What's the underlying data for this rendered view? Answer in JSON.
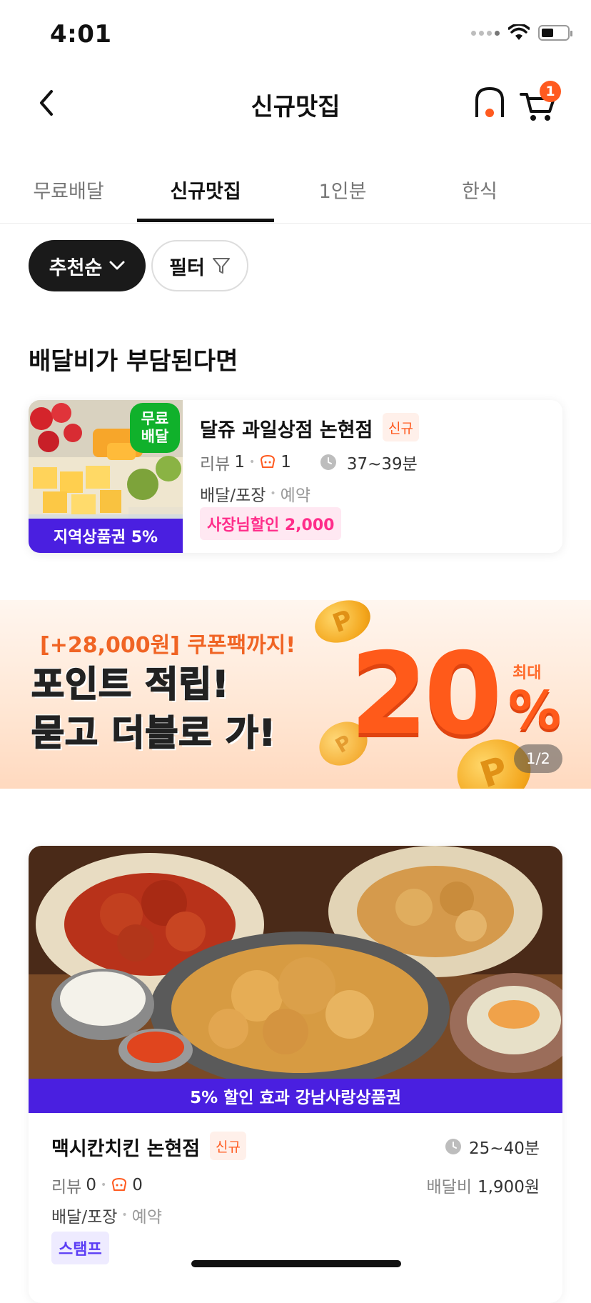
{
  "status_bar": {
    "time": "4:01"
  },
  "header": {
    "title": "신규맛집",
    "cart_count": "1"
  },
  "tabs": [
    {
      "label": "무료배달"
    },
    {
      "label": "신규맛집"
    },
    {
      "label": "1인분"
    },
    {
      "label": "한식"
    }
  ],
  "filters": {
    "sort_label": "추천순",
    "filter_label": "필터"
  },
  "section": {
    "title": "배달비가 부담된다면"
  },
  "store1": {
    "free_badge_line1": "무료",
    "free_badge_line2": "배달",
    "voucher": "지역상품권 5%",
    "name": "달쥬 과일상점 논현점",
    "new_tag": "신규",
    "review_label": "리뷰",
    "review_count": "1",
    "rating_count": "1",
    "delivery_time": "37~39분",
    "mode": "배달/포장",
    "mode_sub": "예약",
    "discount": "사장님할인 2,000"
  },
  "banner": {
    "subtitle": "[+28,000원] 쿠폰팩까지!",
    "line1": "포인트 적립!",
    "line2": "묻고 더블로 가!",
    "big_number": "20",
    "percent": "%",
    "max_label": "최대",
    "pager": "1/2"
  },
  "store2": {
    "voucher": "5% 할인 효과 강남사랑상품권",
    "name": "맥시칸치킨 논현점",
    "new_tag": "신규",
    "delivery_time": "25~40분",
    "review_label": "리뷰",
    "review_count": "0",
    "rating_count": "0",
    "fee_label": "배달비",
    "fee_value": "1,900원",
    "mode": "배달/포장",
    "mode_sub": "예약",
    "stamp": "스탬프"
  },
  "colors": {
    "accent": "#ff5a1f",
    "voucher": "#4a1fe0",
    "free_badge": "#10b12b",
    "discount_text": "#ff2d8a"
  }
}
